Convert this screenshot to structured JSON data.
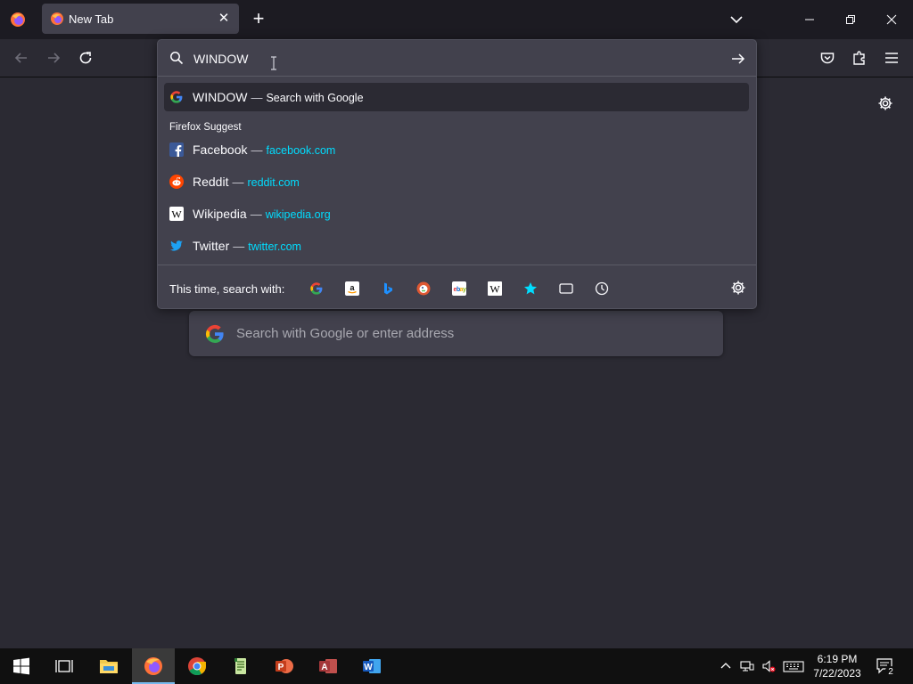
{
  "tab": {
    "title": "New Tab",
    "close": "✕"
  },
  "toolbar": {
    "new_tab": "+"
  },
  "urlbar": {
    "value": "WINDOW",
    "results": [
      {
        "title": "WINDOW",
        "action": "Search with Google",
        "icon": "google-icon"
      }
    ],
    "suggest_label": "Firefox Suggest",
    "suggestions": [
      {
        "title": "Facebook",
        "url": "facebook.com",
        "icon": "facebook-icon"
      },
      {
        "title": "Reddit",
        "url": "reddit.com",
        "icon": "reddit-icon"
      },
      {
        "title": "Wikipedia",
        "url": "wikipedia.org",
        "icon": "wikipedia-icon"
      },
      {
        "title": "Twitter",
        "url": "twitter.com",
        "icon": "twitter-icon"
      }
    ],
    "dash": "—",
    "search_with_label": "This time, search with:",
    "engines": [
      "google",
      "amazon",
      "bing",
      "duckduckgo",
      "ebay",
      "wikipedia",
      "bookmarks",
      "tabs",
      "history"
    ]
  },
  "content": {
    "search_placeholder": "Search with Google or enter address"
  },
  "taskbar": {
    "apps": [
      "start",
      "task-view",
      "file-explorer",
      "firefox",
      "chrome",
      "notepad-plus",
      "powerpoint",
      "access",
      "word"
    ],
    "time": "6:19 PM",
    "date": "7/22/2023",
    "notification_count": "2"
  },
  "colors": {
    "accent_link": "#00ddff",
    "panel_bg": "#42414d",
    "page_bg": "#2b2a33",
    "tabstrip_bg": "#1c1b22"
  }
}
